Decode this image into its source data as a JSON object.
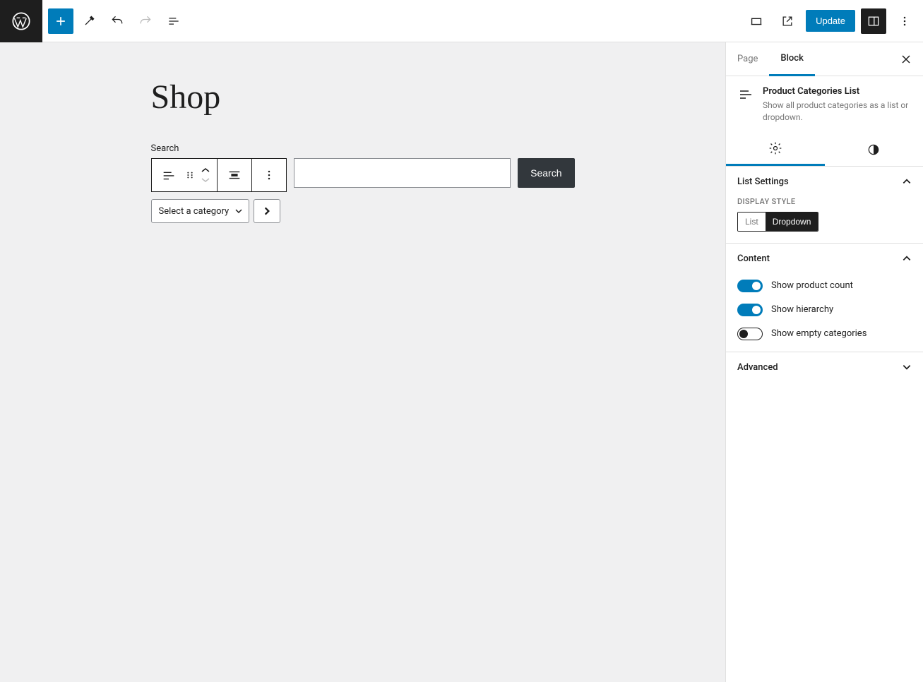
{
  "header": {
    "update_label": "Update"
  },
  "canvas": {
    "page_title": "Shop",
    "search_label": "Search",
    "search_button": "Search",
    "category_placeholder": "Select a category"
  },
  "sidebar": {
    "tabs": {
      "page": "Page",
      "block": "Block"
    },
    "block_card": {
      "title": "Product Categories List",
      "description": "Show all product categories as a list or dropdown."
    },
    "list_settings": {
      "title": "List Settings",
      "display_style_label": "Display Style",
      "options": {
        "list": "List",
        "dropdown": "Dropdown"
      }
    },
    "content": {
      "title": "Content",
      "show_product_count": "Show product count",
      "show_hierarchy": "Show hierarchy",
      "show_empty": "Show empty categories"
    },
    "advanced": {
      "title": "Advanced"
    }
  }
}
